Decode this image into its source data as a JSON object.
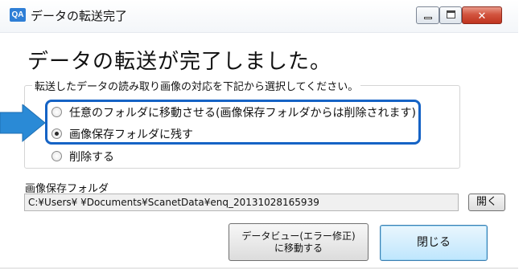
{
  "window": {
    "icon_text": "QA",
    "title": "データの転送完了"
  },
  "heading": "データの転送が完了しました。",
  "options_group": {
    "legend": "転送したデータの読み取り画像の対応を下記から選択してください。",
    "options": [
      {
        "label": "任意のフォルダに移動させる(画像保存フォルダからは削除されます)",
        "checked": false
      },
      {
        "label": "画像保存フォルダに残す",
        "checked": true
      },
      {
        "label": "削除する",
        "checked": false
      }
    ]
  },
  "folder": {
    "label": "画像保存フォルダ",
    "path": "C:¥Users¥        ¥Documents¥ScanetData¥enq_20131028165939",
    "open_button": "開く"
  },
  "buttons": {
    "dataview_line1": "データビュー(エラー修正)",
    "dataview_line2": "に移動する",
    "close": "閉じる"
  },
  "colors": {
    "highlight": "#1563c5",
    "arrow": "#2a8ad6",
    "close_button_face": "#bee6fd"
  }
}
